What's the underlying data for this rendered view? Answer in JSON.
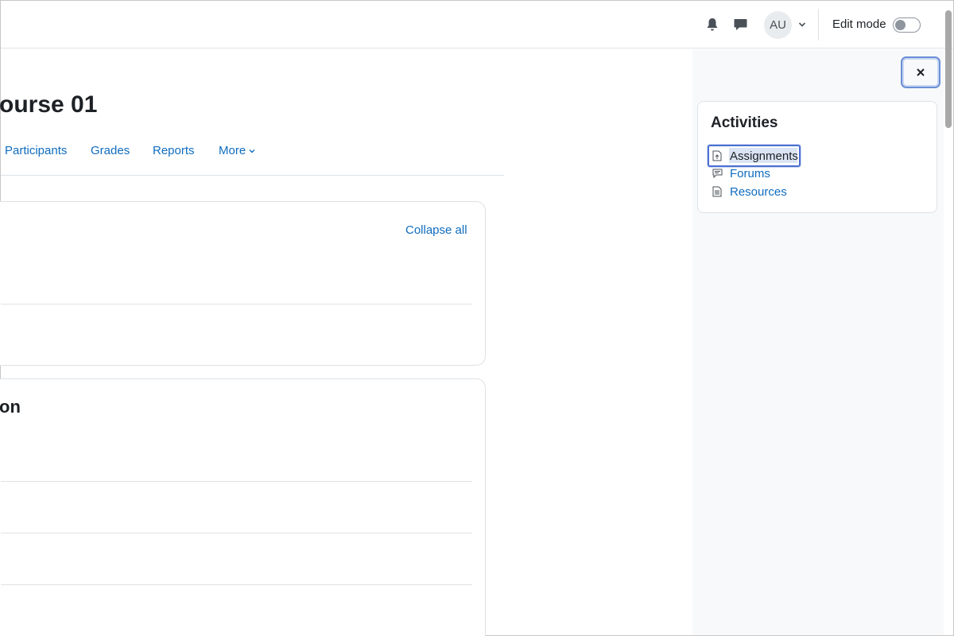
{
  "navbar": {
    "avatar_initials": "AU",
    "edit_mode_label": "Edit mode",
    "edit_mode_on": false
  },
  "course": {
    "title": "ourse 01",
    "nav": [
      "Participants",
      "Grades",
      "Reports",
      "More"
    ],
    "collapse_all": "Collapse all",
    "section2_title_partial": "on"
  },
  "drawer": {
    "block_title": "Activities",
    "items": [
      {
        "label": "Assignments",
        "icon": "assignment-icon"
      },
      {
        "label": "Forums",
        "icon": "forum-icon"
      },
      {
        "label": "Resources",
        "icon": "resource-icon"
      }
    ]
  },
  "colors": {
    "link": "#0f6cbf",
    "text": "#1d2125",
    "drawer_bg": "#f8f9fa",
    "focus": "#4c6fd1"
  }
}
